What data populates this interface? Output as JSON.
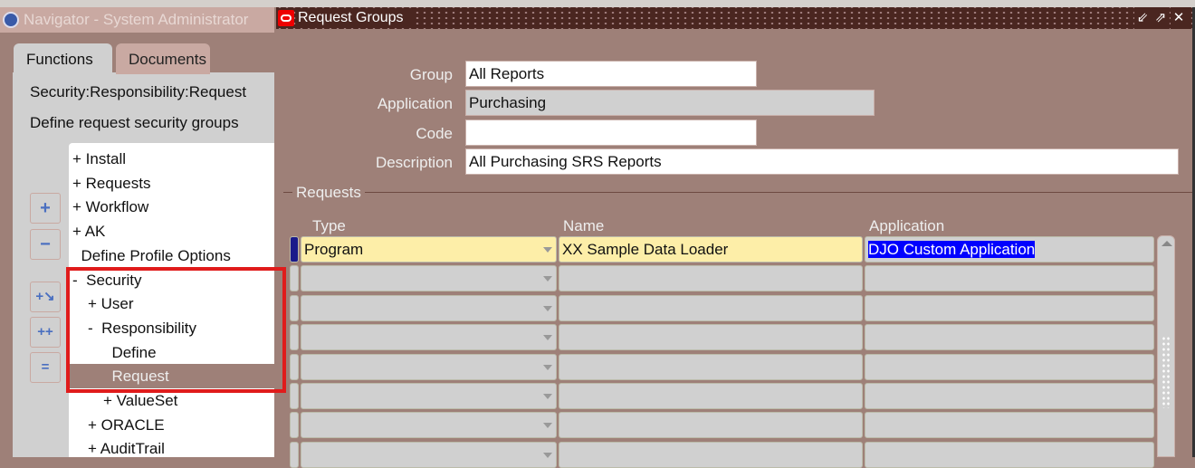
{
  "navigator": {
    "title": "Navigator - System Administrator",
    "tabs": [
      "Functions",
      "Documents"
    ],
    "path": "Security:Responsibility:Request",
    "description": "Define request security groups",
    "tree": [
      {
        "prefix": "+ ",
        "label": "Install",
        "indent": 0
      },
      {
        "prefix": "+ ",
        "label": "Requests",
        "indent": 0
      },
      {
        "prefix": "+ ",
        "label": "Workflow",
        "indent": 0
      },
      {
        "prefix": "+ ",
        "label": "AK",
        "indent": 0
      },
      {
        "prefix": "  ",
        "label": "Define Profile Options",
        "indent": 0
      },
      {
        "prefix": "-  ",
        "label": "Security",
        "indent": 0
      },
      {
        "prefix": "+ ",
        "label": "User",
        "indent": 1
      },
      {
        "prefix": "-  ",
        "label": "Responsibility",
        "indent": 1
      },
      {
        "prefix": "  ",
        "label": "Define",
        "indent": 2
      },
      {
        "prefix": "  ",
        "label": "Request",
        "indent": 2,
        "selected": true
      },
      {
        "prefix": "+ ",
        "label": "ValueSet",
        "indent": 2
      },
      {
        "prefix": "+ ",
        "label": "ORACLE",
        "indent": 1
      },
      {
        "prefix": "+ ",
        "label": "AuditTrail",
        "indent": 1
      }
    ],
    "buttons": [
      "expand",
      "collapse",
      "expand-branch",
      "expand-all",
      "collapse-all"
    ]
  },
  "form": {
    "title": "Request Groups",
    "labels": {
      "group": "Group",
      "application": "Application",
      "code": "Code",
      "description": "Description"
    },
    "values": {
      "group": "All Reports",
      "application": "Purchasing",
      "code": "",
      "description": "All Purchasing SRS Reports"
    },
    "section": "Requests",
    "columns": [
      "Type",
      "Name",
      "Application"
    ],
    "rows": [
      {
        "type": "Program",
        "name": "XX Sample Data Loader",
        "application": "DJO Custom Application"
      },
      {
        "type": "",
        "name": "",
        "application": ""
      },
      {
        "type": "",
        "name": "",
        "application": ""
      },
      {
        "type": "",
        "name": "",
        "application": ""
      },
      {
        "type": "",
        "name": "",
        "application": ""
      },
      {
        "type": "",
        "name": "",
        "application": ""
      },
      {
        "type": "",
        "name": "",
        "application": ""
      },
      {
        "type": "",
        "name": "",
        "application": ""
      }
    ]
  }
}
